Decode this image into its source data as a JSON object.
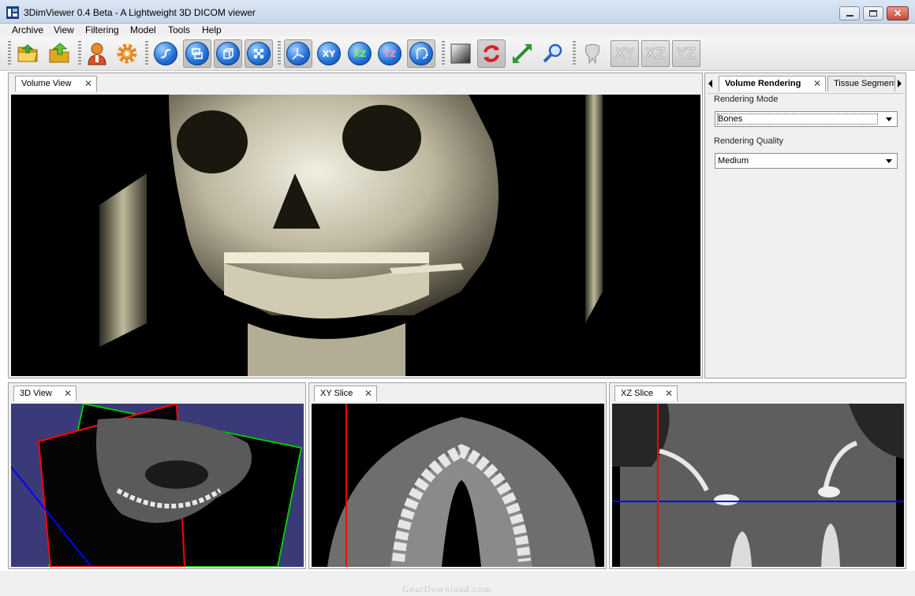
{
  "window": {
    "title": "3DimViewer 0.4 Beta - A Lightweight 3D DICOM viewer",
    "controls": [
      "minimize",
      "maximize",
      "close"
    ]
  },
  "menu": [
    "Archive",
    "View",
    "Filtering",
    "Model",
    "Tools",
    "Help"
  ],
  "toolbar": {
    "groups": [
      [
        "open-folder-icon",
        "save-export-icon"
      ],
      [
        "user-icon",
        "gear-icon"
      ],
      [
        "curve-icon",
        "window-layout-icon",
        "cube-icon",
        "checker-icon"
      ],
      [
        "axes-icon",
        "XY",
        "XZ",
        "YZ",
        "head-icon"
      ],
      [
        "gradient-icon",
        "refresh-icon",
        "zoom-extents-icon",
        "magnifier-icon"
      ],
      [
        "tooth-icon",
        "XY",
        "XZ",
        "YZ"
      ]
    ]
  },
  "volume_view": {
    "tab_label": "Volume View"
  },
  "side_panel": {
    "tabs": [
      "Volume Rendering",
      "Tissue Segment"
    ],
    "rendering_mode_label": "Rendering Mode",
    "rendering_mode_value": "Bones",
    "rendering_quality_label": "Rendering Quality",
    "rendering_quality_value": "Medium"
  },
  "bottom_views": [
    {
      "tab_label": "3D View"
    },
    {
      "tab_label": "XY Slice"
    },
    {
      "tab_label": "XZ Slice"
    }
  ],
  "watermark": "GearDownload.com",
  "colors": {
    "crosshair_red": "#ff0000",
    "crosshair_blue": "#0000ff",
    "plane_green": "#00c800",
    "viewport_3d_bg": "#3a3a78"
  }
}
